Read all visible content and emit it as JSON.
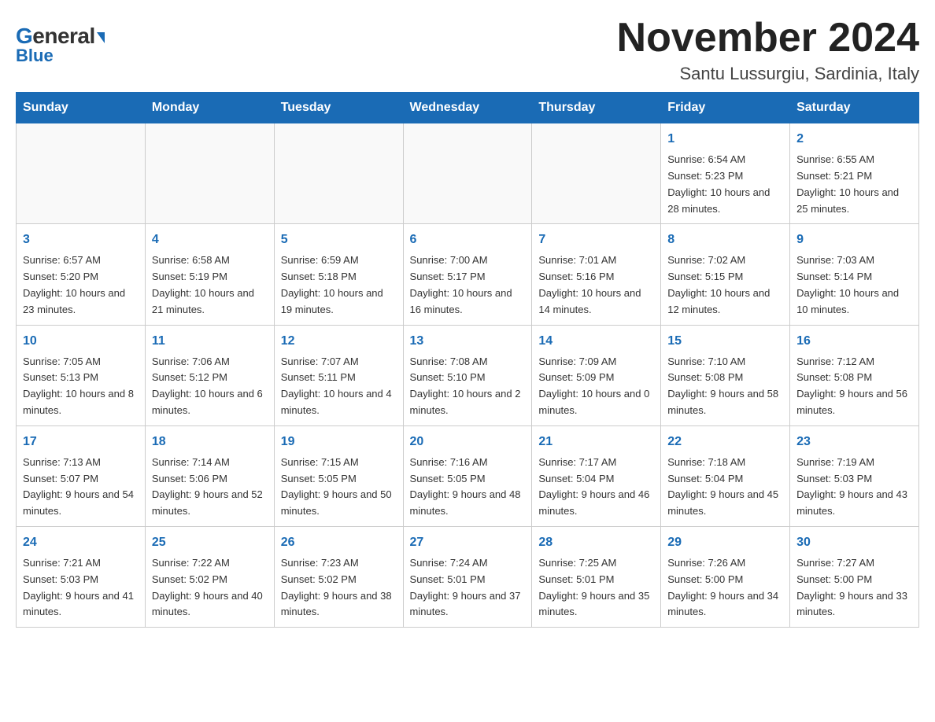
{
  "header": {
    "title": "November 2024",
    "subtitle": "Santu Lussurgiu, Sardinia, Italy",
    "logo_general": "General",
    "logo_blue": "Blue"
  },
  "days_of_week": [
    "Sunday",
    "Monday",
    "Tuesday",
    "Wednesday",
    "Thursday",
    "Friday",
    "Saturday"
  ],
  "weeks": [
    [
      {
        "day": "",
        "info": ""
      },
      {
        "day": "",
        "info": ""
      },
      {
        "day": "",
        "info": ""
      },
      {
        "day": "",
        "info": ""
      },
      {
        "day": "",
        "info": ""
      },
      {
        "day": "1",
        "info": "Sunrise: 6:54 AM\nSunset: 5:23 PM\nDaylight: 10 hours and 28 minutes."
      },
      {
        "day": "2",
        "info": "Sunrise: 6:55 AM\nSunset: 5:21 PM\nDaylight: 10 hours and 25 minutes."
      }
    ],
    [
      {
        "day": "3",
        "info": "Sunrise: 6:57 AM\nSunset: 5:20 PM\nDaylight: 10 hours and 23 minutes."
      },
      {
        "day": "4",
        "info": "Sunrise: 6:58 AM\nSunset: 5:19 PM\nDaylight: 10 hours and 21 minutes."
      },
      {
        "day": "5",
        "info": "Sunrise: 6:59 AM\nSunset: 5:18 PM\nDaylight: 10 hours and 19 minutes."
      },
      {
        "day": "6",
        "info": "Sunrise: 7:00 AM\nSunset: 5:17 PM\nDaylight: 10 hours and 16 minutes."
      },
      {
        "day": "7",
        "info": "Sunrise: 7:01 AM\nSunset: 5:16 PM\nDaylight: 10 hours and 14 minutes."
      },
      {
        "day": "8",
        "info": "Sunrise: 7:02 AM\nSunset: 5:15 PM\nDaylight: 10 hours and 12 minutes."
      },
      {
        "day": "9",
        "info": "Sunrise: 7:03 AM\nSunset: 5:14 PM\nDaylight: 10 hours and 10 minutes."
      }
    ],
    [
      {
        "day": "10",
        "info": "Sunrise: 7:05 AM\nSunset: 5:13 PM\nDaylight: 10 hours and 8 minutes."
      },
      {
        "day": "11",
        "info": "Sunrise: 7:06 AM\nSunset: 5:12 PM\nDaylight: 10 hours and 6 minutes."
      },
      {
        "day": "12",
        "info": "Sunrise: 7:07 AM\nSunset: 5:11 PM\nDaylight: 10 hours and 4 minutes."
      },
      {
        "day": "13",
        "info": "Sunrise: 7:08 AM\nSunset: 5:10 PM\nDaylight: 10 hours and 2 minutes."
      },
      {
        "day": "14",
        "info": "Sunrise: 7:09 AM\nSunset: 5:09 PM\nDaylight: 10 hours and 0 minutes."
      },
      {
        "day": "15",
        "info": "Sunrise: 7:10 AM\nSunset: 5:08 PM\nDaylight: 9 hours and 58 minutes."
      },
      {
        "day": "16",
        "info": "Sunrise: 7:12 AM\nSunset: 5:08 PM\nDaylight: 9 hours and 56 minutes."
      }
    ],
    [
      {
        "day": "17",
        "info": "Sunrise: 7:13 AM\nSunset: 5:07 PM\nDaylight: 9 hours and 54 minutes."
      },
      {
        "day": "18",
        "info": "Sunrise: 7:14 AM\nSunset: 5:06 PM\nDaylight: 9 hours and 52 minutes."
      },
      {
        "day": "19",
        "info": "Sunrise: 7:15 AM\nSunset: 5:05 PM\nDaylight: 9 hours and 50 minutes."
      },
      {
        "day": "20",
        "info": "Sunrise: 7:16 AM\nSunset: 5:05 PM\nDaylight: 9 hours and 48 minutes."
      },
      {
        "day": "21",
        "info": "Sunrise: 7:17 AM\nSunset: 5:04 PM\nDaylight: 9 hours and 46 minutes."
      },
      {
        "day": "22",
        "info": "Sunrise: 7:18 AM\nSunset: 5:04 PM\nDaylight: 9 hours and 45 minutes."
      },
      {
        "day": "23",
        "info": "Sunrise: 7:19 AM\nSunset: 5:03 PM\nDaylight: 9 hours and 43 minutes."
      }
    ],
    [
      {
        "day": "24",
        "info": "Sunrise: 7:21 AM\nSunset: 5:03 PM\nDaylight: 9 hours and 41 minutes."
      },
      {
        "day": "25",
        "info": "Sunrise: 7:22 AM\nSunset: 5:02 PM\nDaylight: 9 hours and 40 minutes."
      },
      {
        "day": "26",
        "info": "Sunrise: 7:23 AM\nSunset: 5:02 PM\nDaylight: 9 hours and 38 minutes."
      },
      {
        "day": "27",
        "info": "Sunrise: 7:24 AM\nSunset: 5:01 PM\nDaylight: 9 hours and 37 minutes."
      },
      {
        "day": "28",
        "info": "Sunrise: 7:25 AM\nSunset: 5:01 PM\nDaylight: 9 hours and 35 minutes."
      },
      {
        "day": "29",
        "info": "Sunrise: 7:26 AM\nSunset: 5:00 PM\nDaylight: 9 hours and 34 minutes."
      },
      {
        "day": "30",
        "info": "Sunrise: 7:27 AM\nSunset: 5:00 PM\nDaylight: 9 hours and 33 minutes."
      }
    ]
  ]
}
